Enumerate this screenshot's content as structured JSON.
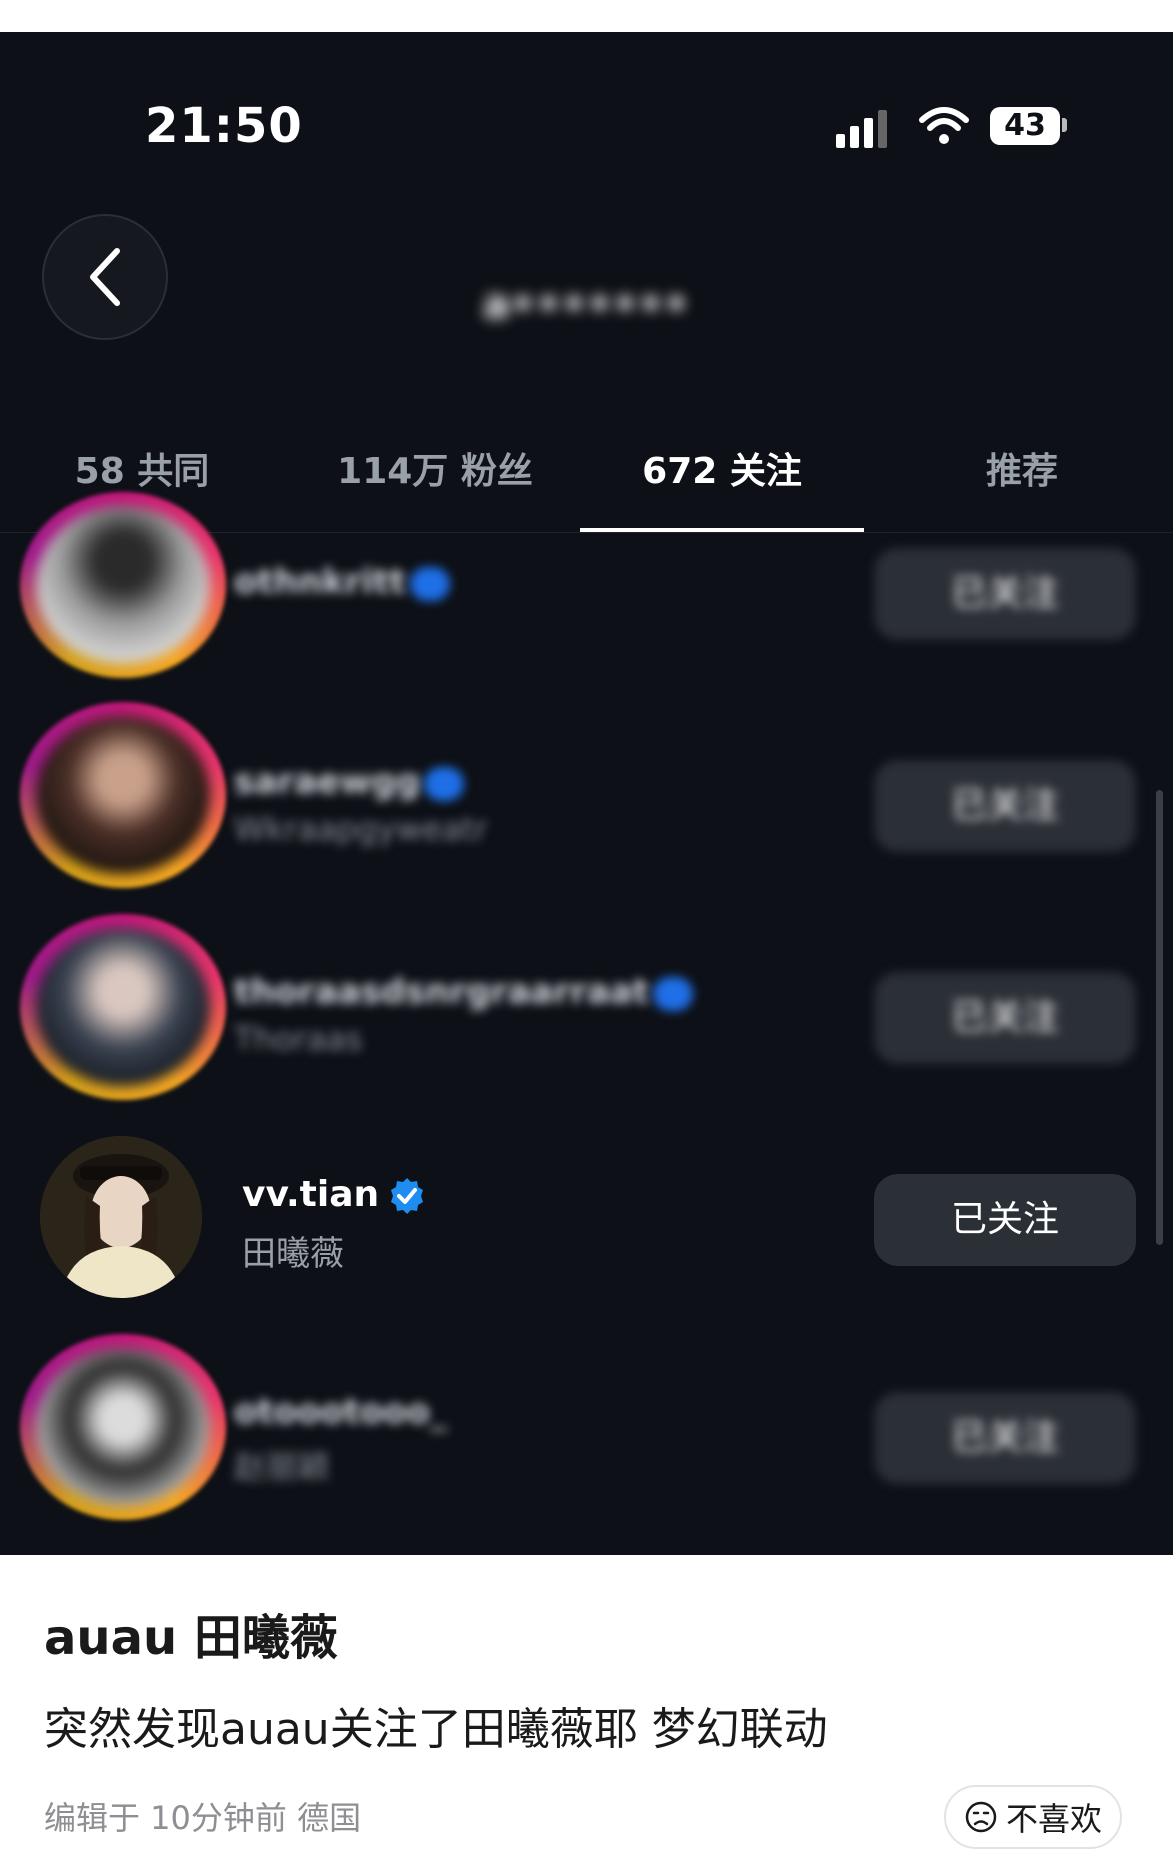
{
  "status_bar": {
    "time": "21:50",
    "battery": "43"
  },
  "header": {
    "title": "a•••••••"
  },
  "tabs": [
    {
      "label": "58 共同",
      "active": false
    },
    {
      "label": "114万 粉丝",
      "active": false
    },
    {
      "label": "672 关注",
      "active": true
    },
    {
      "label": "推荐",
      "active": false
    }
  ],
  "following": [
    {
      "username": "othnkritt",
      "subtitle": "",
      "button": "已关注",
      "blurred": true,
      "verified": true
    },
    {
      "username": "saraewgg",
      "subtitle": "Wkraapgyweatr",
      "button": "已关注",
      "blurred": true,
      "verified": true
    },
    {
      "username": "thoraasdsnrgraarraat",
      "subtitle": "Thoraas",
      "button": "已关注",
      "blurred": true,
      "verified": true
    },
    {
      "username": "vv.tian",
      "subtitle": "田曦薇",
      "button": "已关注",
      "blurred": false,
      "verified": true
    },
    {
      "username": "otoootooo_",
      "subtitle": "赵丽颖",
      "button": "已关注",
      "blurred": true,
      "verified": false
    }
  ],
  "post": {
    "title": "auau 田曦薇",
    "body": "突然发现auau关注了田曦薇耶 梦幻联动",
    "meta": "编辑于 10分钟前 德国",
    "dislike_label": "不喜欢"
  },
  "colors": {
    "background": "#0d1016",
    "button": "#2b2f36",
    "verified": "#1f8cf0",
    "story_ring": "#c2187a"
  },
  "icons": [
    "back-icon",
    "signal-icon",
    "wifi-icon",
    "battery-icon",
    "verified-badge-icon",
    "frown-face-icon"
  ]
}
